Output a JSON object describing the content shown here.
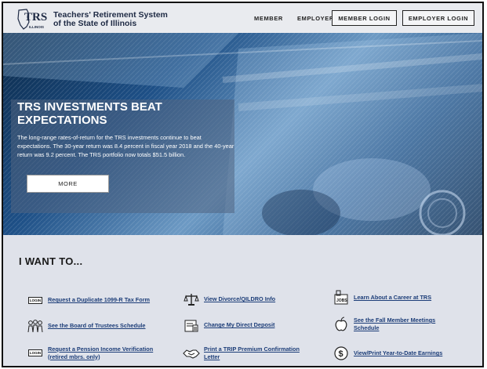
{
  "header": {
    "logo_text": "TRS",
    "logo_sub": "ILLINOIS",
    "org_line1": "Teachers' Retirement System",
    "org_line2": "of the State of Illinois",
    "nav": [
      "MEMBER",
      "EMPLOYER"
    ],
    "member_login": "MEMBER LOGIN",
    "employer_login": "EMPLOYER LOGIN"
  },
  "hero": {
    "title": "TRS INVESTMENTS BEAT EXPECTATIONS",
    "body": "The long-range rates-of-return for the TRS investments continue to beat expectations. The 30-year return was 8.4 percent in fiscal year 2018 and the 40-year return was 9.2 percent. The TRS portfolio now totals $51.5 billion.",
    "more_label": "MORE"
  },
  "want": {
    "title": "I WANT TO...",
    "items": [
      {
        "label": "Request a Duplicate 1099-R Tax Form",
        "icon": "login-badge-icon"
      },
      {
        "label": "View Divorce/QILDRO Info",
        "icon": "scales-icon"
      },
      {
        "label": "Learn About a Career at TRS",
        "icon": "jobs-icon"
      },
      {
        "label": "See the Board of Trustees Schedule",
        "icon": "people-icon"
      },
      {
        "label": "Change My Direct Deposit",
        "icon": "bank-icon"
      },
      {
        "label": "See the Fall Member Meetings Schedule",
        "icon": "apple-icon"
      },
      {
        "label": "Request a Pension Income Verification (retired mbrs. only)",
        "icon": "login-badge-icon"
      },
      {
        "label": "Print a TRIP Premium Confirmation Letter",
        "icon": "handshake-icon"
      },
      {
        "label": "View/Print Year-to-Date Earnings",
        "icon": "dollar-icon"
      }
    ],
    "badge_text": "LOGIN",
    "jobs_text": "JOBS"
  }
}
